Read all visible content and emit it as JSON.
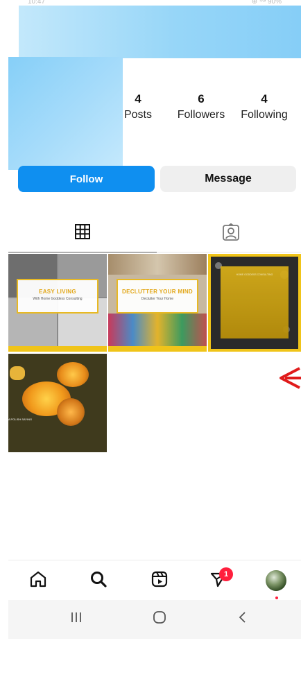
{
  "status_bar": {
    "time": "10:47",
    "right": "⊕ ⁴ᴳ 90%"
  },
  "stats": {
    "posts": {
      "value": "4",
      "label": "Posts"
    },
    "followers": {
      "value": "6",
      "label": "Followers"
    },
    "following": {
      "value": "4",
      "label": "Following"
    }
  },
  "buttons": {
    "follow": "Follow",
    "message": "Message"
  },
  "tabs": [
    {
      "name": "grid",
      "icon": "grid-icon",
      "active": true
    },
    {
      "name": "tagged",
      "icon": "tagged-person-icon",
      "active": false
    }
  ],
  "posts": [
    {
      "title": "EASY LIVING",
      "subtitle": "With Home Goddess Consulting"
    },
    {
      "title": "DECLUTTER YOUR MIND",
      "subtitle": "Declutter Your Home"
    },
    {
      "title": "HOME GODDESS CONSULTING"
    },
    {
      "caption": "A POLISH SAYING"
    }
  ],
  "bottom_nav": {
    "items": [
      "home-icon",
      "search-icon",
      "reels-icon",
      "direct-message-icon",
      "profile-avatar"
    ],
    "dm_badge": "1"
  },
  "system_nav": [
    "recent-apps-icon",
    "home-circle-icon",
    "back-chevron-icon"
  ],
  "colors": {
    "accent": "#0f8ff0",
    "badge": "#ff1f3d",
    "highlight": "#f0c419",
    "redaction": "#97d6f8",
    "annotation_arrow": "#e01b1b"
  }
}
